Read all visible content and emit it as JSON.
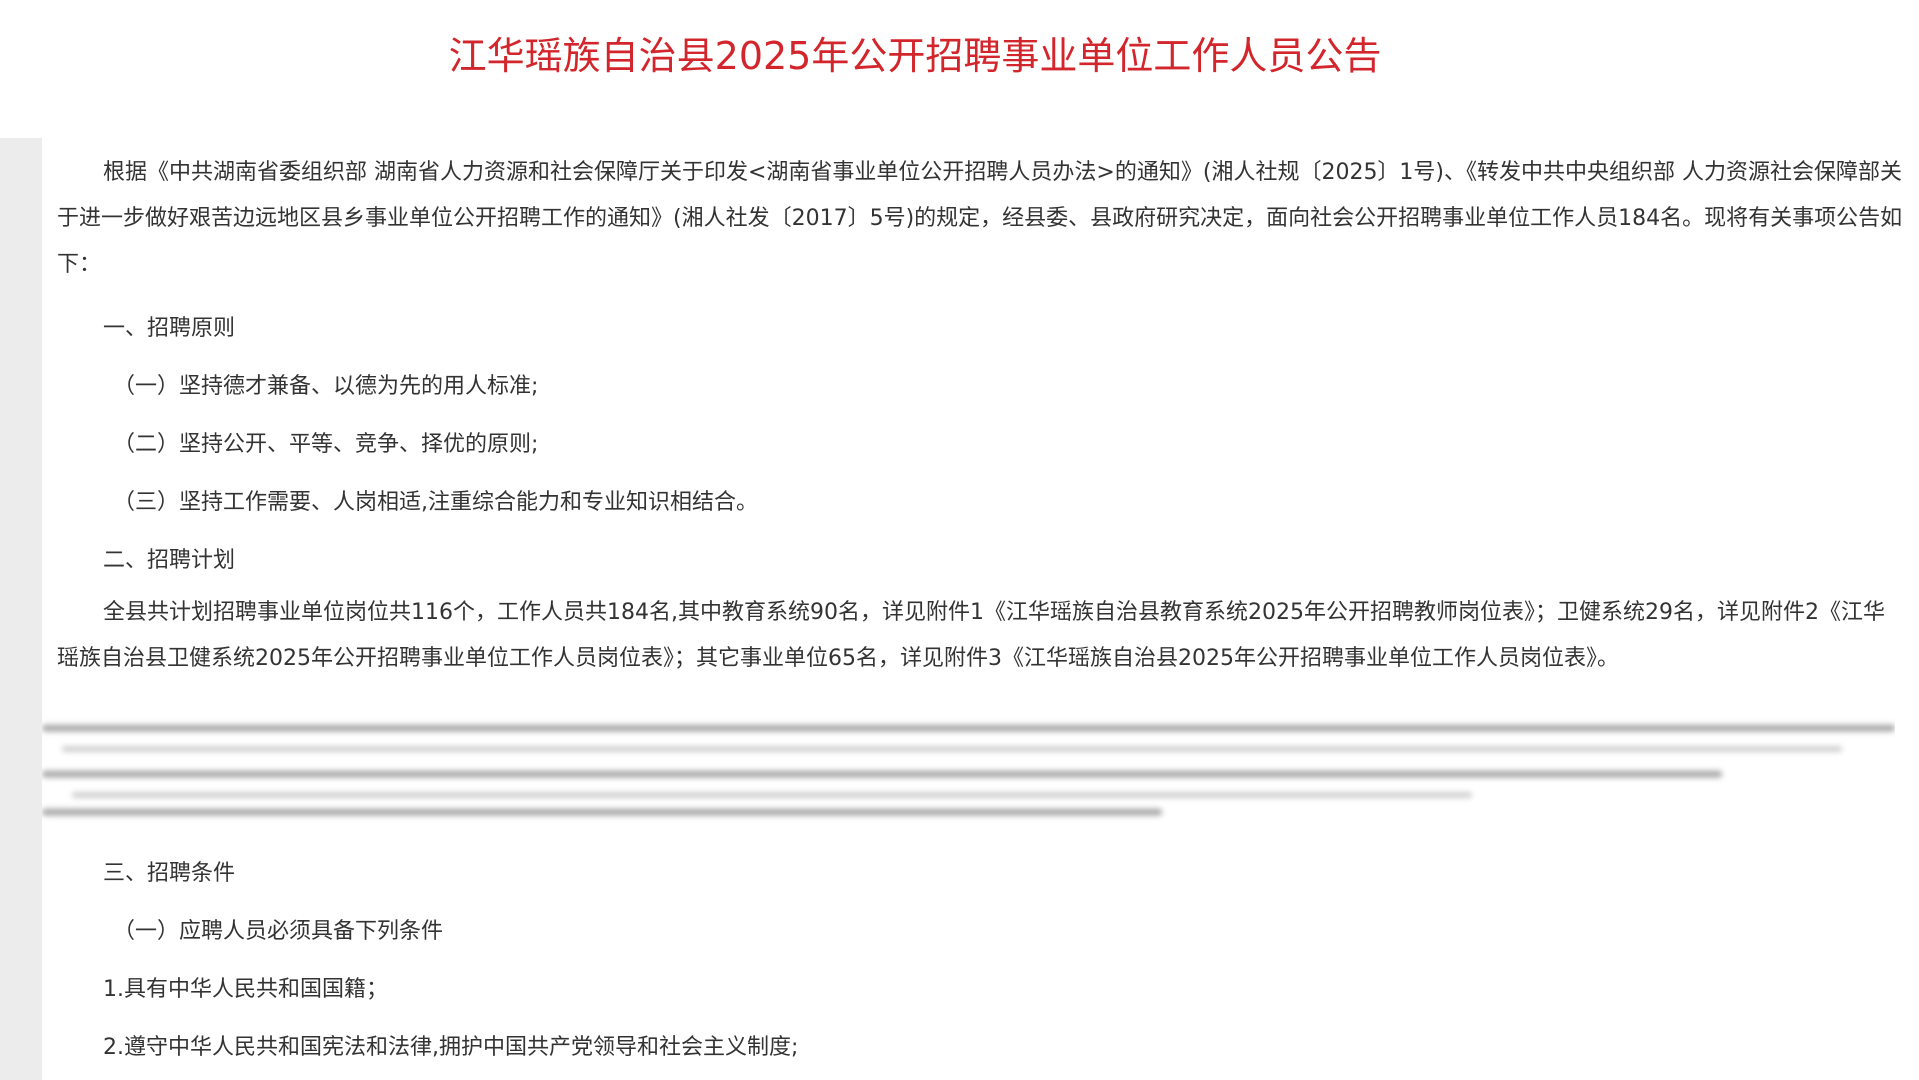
{
  "document": {
    "title": "江华瑶族自治县2025年公开招聘事业单位工作人员公告",
    "intro": "根据《中共湖南省委组织部 湖南省人力资源和社会保障厅关于印发<湖南省事业单位公开招聘人员办法>的通知》(湘人社规〔2025〕1号)、《转发中共中央组织部 人力资源社会保障部关于进一步做好艰苦边远地区县乡事业单位公开招聘工作的通知》(湘人社发〔2017〕5号)的规定，经县委、县政府研究决定，面向社会公开招聘事业单位工作人员184名。现将有关事项公告如下：",
    "section1_heading": "一、招聘原则",
    "principles": [
      "（一）坚持德才兼备、以德为先的用人标准;",
      "（二）坚持公开、平等、竞争、择优的原则;",
      "（三）坚持工作需要、人岗相适,注重综合能力和专业知识相结合。"
    ],
    "section2_heading": "二、招聘计划",
    "plan_paragraph": "全县共计划招聘事业单位岗位共116个，工作人员共184名,其中教育系统90名，详见附件1《江华瑶族自治县教育系统2025年公开招聘教师岗位表》；卫健系统29名，详见附件2《江华瑶族自治县卫健系统2025年公开招聘事业单位工作人员岗位表》；其它事业单位65名，详见附件3《江华瑶族自治县2025年公开招聘事业单位工作人员岗位表》。",
    "section3_heading": "三、招聘条件",
    "condition_sub1": "（一）应聘人员必须具备下列条件",
    "conditions": [
      "1.具有中华人民共和国国籍；",
      "2.遵守中华人民共和国宪法和法律,拥护中国共产党领导和社会主义制度;"
    ]
  }
}
